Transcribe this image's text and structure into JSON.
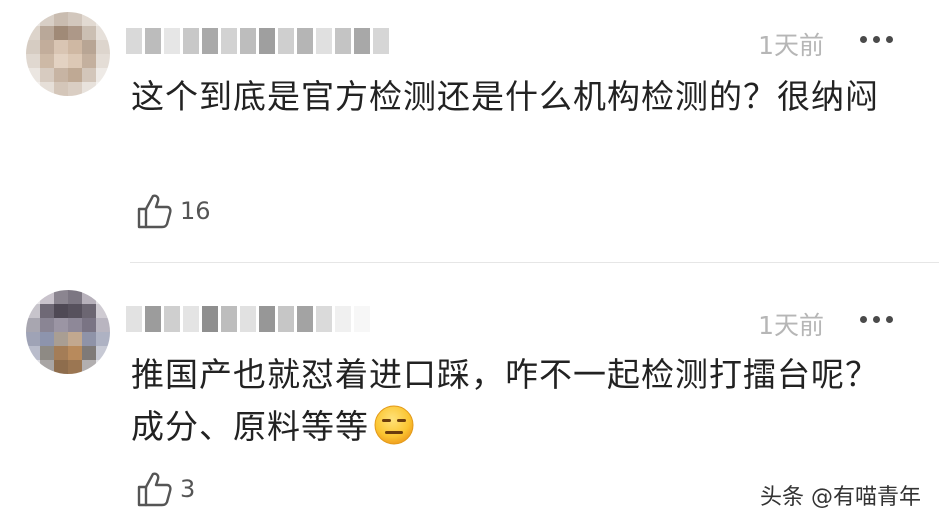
{
  "comments": [
    {
      "time": "1天前",
      "text": "这个到底是官方检测还是什么机构检测的？很纳闷",
      "likes": "16",
      "more_icon": "more-horizontal-icon",
      "like_icon": "thumbs-up-icon"
    },
    {
      "time": "1天前",
      "text": "推国产也就怼着进口踩，咋不一起检测打擂台呢？成分、原料等等",
      "emoji": "expressionless-face-emoji",
      "likes": "3",
      "more_icon": "more-horizontal-icon",
      "like_icon": "thumbs-up-icon"
    }
  ],
  "watermark": "头条 @有喵青年"
}
